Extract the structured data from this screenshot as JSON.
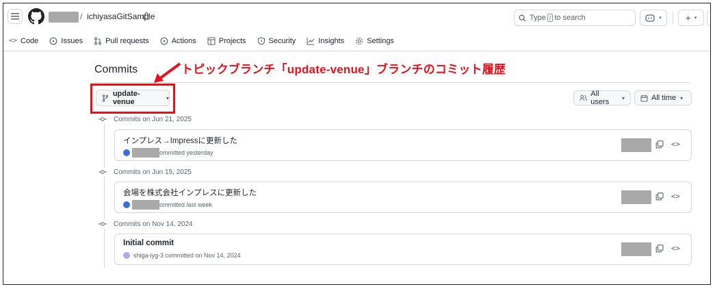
{
  "header": {
    "repo_name": "ichiyasaGitSample",
    "separator": "/",
    "search_placeholder_before": "Type",
    "search_key": "/",
    "search_placeholder_after": "to search"
  },
  "repo_nav": {
    "items": [
      {
        "label": "Code",
        "icon": "code-icon"
      },
      {
        "label": "Issues",
        "icon": "issue-icon"
      },
      {
        "label": "Pull requests",
        "icon": "pull-request-icon"
      },
      {
        "label": "Actions",
        "icon": "play-icon"
      },
      {
        "label": "Projects",
        "icon": "table-icon"
      },
      {
        "label": "Security",
        "icon": "shield-icon"
      },
      {
        "label": "Insights",
        "icon": "graph-icon"
      },
      {
        "label": "Settings",
        "icon": "gear-icon"
      }
    ]
  },
  "page": {
    "title": "Commits",
    "annotation": "トピックブランチ「update-venue」ブランチのコミット履歴",
    "branch_label": "update-venue",
    "users_filter": "All users",
    "time_filter": "All time"
  },
  "commit_groups": [
    {
      "date_label": "Commits on Jun 21, 2025",
      "commit": {
        "message": "インプレス→Impressに更新した",
        "meta": "ommitted yesterday",
        "author": "",
        "bold": false
      }
    },
    {
      "date_label": "Commits on Jun 15, 2025",
      "commit": {
        "message": "会場を株式会社インプレスに更新した",
        "meta": "ommitted last week",
        "author": "",
        "bold": false
      }
    },
    {
      "date_label": "Commits on Nov 14, 2024",
      "commit": {
        "message": "Initial commit",
        "meta": "shiga-iyg-3 committed on Nov 14, 2024",
        "author": "shiga-iyg-3",
        "bold": true
      }
    }
  ],
  "colors": {
    "annotation_red": "#e3121b",
    "border": "#d1d9e0",
    "muted_text": "#59636e"
  }
}
